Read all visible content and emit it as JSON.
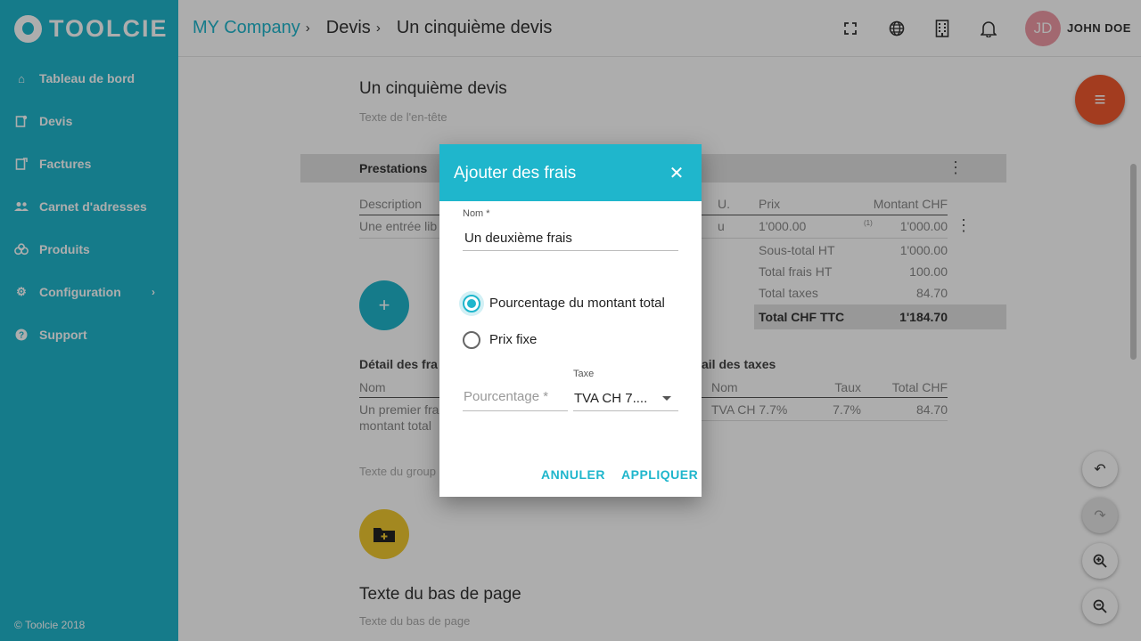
{
  "app": {
    "logo_text": "TOOLCIE",
    "copyright": "© Toolcie 2018"
  },
  "sidebar": {
    "items": [
      {
        "label": "Tableau de bord",
        "icon": "home-icon"
      },
      {
        "label": "Devis",
        "icon": "quote-icon"
      },
      {
        "label": "Factures",
        "icon": "invoice-icon"
      },
      {
        "label": "Carnet d'adresses",
        "icon": "contacts-icon"
      },
      {
        "label": "Produits",
        "icon": "products-icon"
      },
      {
        "label": "Configuration",
        "icon": "gear-icon"
      },
      {
        "label": "Support",
        "icon": "help-icon"
      }
    ]
  },
  "breadcrumb": {
    "root": "MY Company",
    "level1": "Devis",
    "current": "Un cinquième devis"
  },
  "user": {
    "initials": "JD",
    "name": "JOHN DOE"
  },
  "document": {
    "title": "Un cinquième devis",
    "header_placeholder": "Texte de l'en-tête",
    "section_label": "Prestations",
    "columns": {
      "description": "Description",
      "unit": "U.",
      "price": "Prix",
      "amount": "Montant CHF"
    },
    "row": {
      "description": "Une entrée lib",
      "unit": "u",
      "price": "1'000.00",
      "note": "(1)",
      "amount": "1'000.00"
    },
    "totals": [
      {
        "label": "Sous-total HT",
        "value": "1'000.00"
      },
      {
        "label": "Total frais HT",
        "value": "100.00"
      },
      {
        "label": "Total taxes",
        "value": "84.70"
      }
    ],
    "grand_total": {
      "label": "Total CHF TTC",
      "value": "1'184.70"
    },
    "fees_detail": {
      "title": "Détail des fra",
      "col_name": "Nom",
      "row_line1": "Un premier fra",
      "row_line2": "montant total"
    },
    "tax_detail": {
      "title": "ail des taxes",
      "col_name": "Nom",
      "col_rate": "Taux",
      "col_total": "Total CHF",
      "row_name": "TVA CH 7.7%",
      "row_rate": "7.7%",
      "row_total": "84.70"
    },
    "group_placeholder": "Texte du group",
    "footer_title": "Texte du bas de page",
    "footer_placeholder": "Texte du bas de page"
  },
  "dialog": {
    "title": "Ajouter des frais",
    "name_label": "Nom *",
    "name_value": "Un deuxième frais",
    "option_percentage": "Pourcentage du montant total",
    "option_fixed": "Prix fixe",
    "percentage_placeholder": "Pourcentage *",
    "tax_label": "Taxe",
    "tax_value": "TVA CH 7....",
    "cancel": "ANNULER",
    "apply": "APPLIQUER",
    "selected_option": "percentage"
  },
  "colors": {
    "accent": "#1fb6cc",
    "fab_menu": "#f1592e",
    "fab_folder": "#f0c930",
    "avatar": "#ef9aa6"
  }
}
